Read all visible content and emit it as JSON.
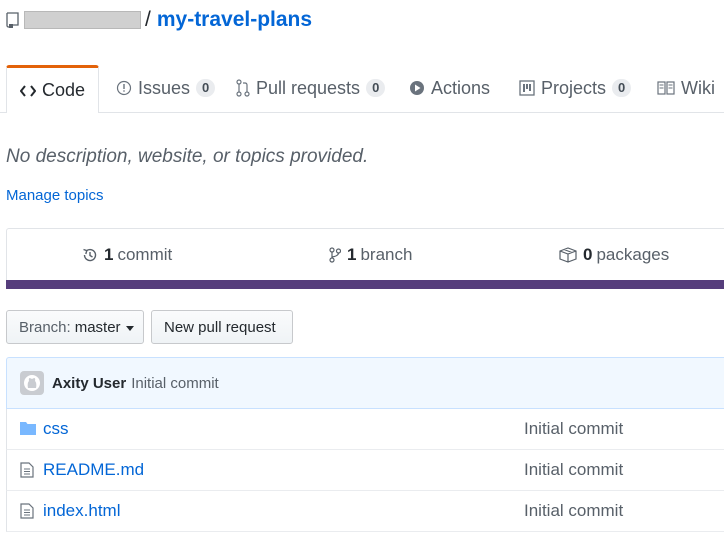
{
  "repo": {
    "name": "my-travel-plans",
    "separator": "/"
  },
  "tabs": [
    {
      "label": "Code",
      "icon": "code-icon",
      "selected": true
    },
    {
      "label": "Issues",
      "icon": "issue-icon",
      "count": "0"
    },
    {
      "label": "Pull requests",
      "icon": "pull-request-icon",
      "count": "0"
    },
    {
      "label": "Actions",
      "icon": "play-icon"
    },
    {
      "label": "Projects",
      "icon": "project-icon",
      "count": "0"
    },
    {
      "label": "Wiki",
      "icon": "book-icon"
    }
  ],
  "description": "No description, website, or topics provided.",
  "manage_topics": "Manage topics",
  "summary": {
    "commits": {
      "count": "1",
      "label": "commit",
      "icon": "history-icon"
    },
    "branches": {
      "count": "1",
      "label": "branch",
      "icon": "branch-icon"
    },
    "packages": {
      "count": "0",
      "label": "packages",
      "icon": "package-icon"
    }
  },
  "language_bar_color": "#563d7c",
  "branch_select": {
    "prefix": "Branch:",
    "value": "master"
  },
  "new_pr_button": "New pull request",
  "latest_commit": {
    "author": "Axity User",
    "message": "Initial commit",
    "avatar_icon": "github-avatar-icon"
  },
  "files": [
    {
      "name": "css",
      "type": "directory",
      "icon": "folder-icon",
      "message": "Initial commit"
    },
    {
      "name": "README.md",
      "type": "file",
      "icon": "file-icon",
      "message": "Initial commit"
    },
    {
      "name": "index.html",
      "type": "file",
      "icon": "file-icon",
      "message": "Initial commit"
    }
  ]
}
